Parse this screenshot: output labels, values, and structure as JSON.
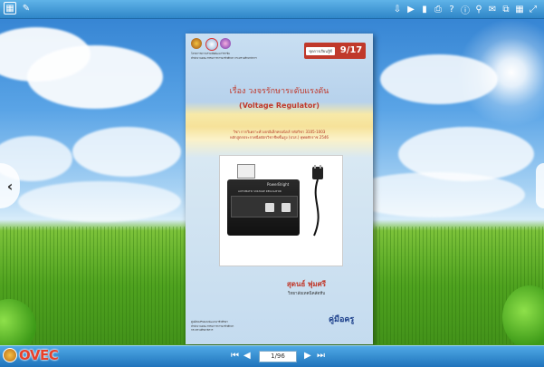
{
  "toolbar": {
    "left_icons": [
      "book-icon",
      "edit-icon"
    ],
    "right_icons": [
      "download-icon",
      "play-icon",
      "bookmark-icon",
      "print-icon",
      "help-icon",
      "info-icon",
      "zoom-icon",
      "email-icon",
      "share-icon",
      "grid-icon",
      "fullscreen-icon"
    ]
  },
  "document": {
    "org_lines": [
      "โครงการความร่วมมือพัฒนาวิชาชีพ",
      "สำนักงานคณะกรรมการการอาชีวศึกษา กระทรวงศึกษาธิการ"
    ],
    "unit_label": "ชุดการเรียนรู้ที่",
    "unit_number": "9/17",
    "title_th": "เรื่อง วงจรรักษาระดับแรงดัน",
    "title_en": "(Voltage Regulator)",
    "subject_line": "วิชา การวิเคราะห์วงจรอิเล็กทรอนิกส์ รหัสวิชา 3105-1003",
    "curriculum_line": "หลักสูตรประกาศนียบัตรวิชาชีพชั้นสูง (ปวส.) พุทธศักราช 2546",
    "photo": {
      "brand": "PowerBright",
      "product": "AUTOMATIC VOLTAGE REGULATOR",
      "meter_label": "OUTPUT METER"
    },
    "author": "สุดนธ์ พุ่มศรี",
    "school": "วิทยาลัยเทคนิคสัตหีบ",
    "footer_lines": [
      "ศูนย์ส่งเสริมและพัฒนาอาชีวศึกษา",
      "สำนักงานคณะกรรมการการอาชีวศึกษา",
      "กระทรวงศึกษาธิการ"
    ],
    "manual_label": "คู่มือครู"
  },
  "navigation": {
    "page_indicator": "1/96",
    "first": "⏮",
    "prev": "◀",
    "next": "▶",
    "last": "⏭"
  },
  "brand": {
    "logo_text": "OVEC"
  },
  "colors": {
    "accent_red": "#c0392b",
    "toolbar_blue": "#2f86c8"
  }
}
